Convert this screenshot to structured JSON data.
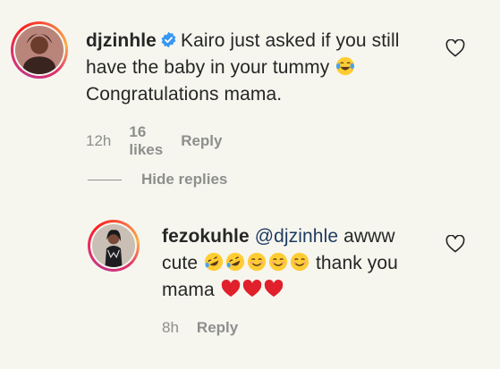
{
  "comment": {
    "username": "djzinhle",
    "verified": true,
    "text_part1": "Kairo just asked if you still have the baby in your tummy",
    "emoji_after_text": "face-with-tears-of-joy",
    "text_part2": "Congratulations mama.",
    "time": "12h",
    "likes": "16 likes",
    "reply_label": "Reply"
  },
  "replies_toggle": {
    "label": "Hide replies"
  },
  "reply": {
    "username": "fezokuhle",
    "mention": "@djzinhle",
    "text_part1": "awww cute",
    "emojis_a": [
      "rolling-on-floor-laughing",
      "rolling-on-floor-laughing",
      "smiling-face",
      "smiling-face",
      "smiling-face"
    ],
    "text_part2": "thank you mama",
    "emojis_b": [
      "red-heart",
      "red-heart",
      "red-heart"
    ],
    "time": "8h",
    "reply_label": "Reply"
  },
  "colors": {
    "background": "#f6f6ef",
    "text": "#262626",
    "meta": "#8e8e8e",
    "verified": "#3897f0",
    "heart": "#e0202a",
    "emoji_yellow": "#ffcc33"
  }
}
